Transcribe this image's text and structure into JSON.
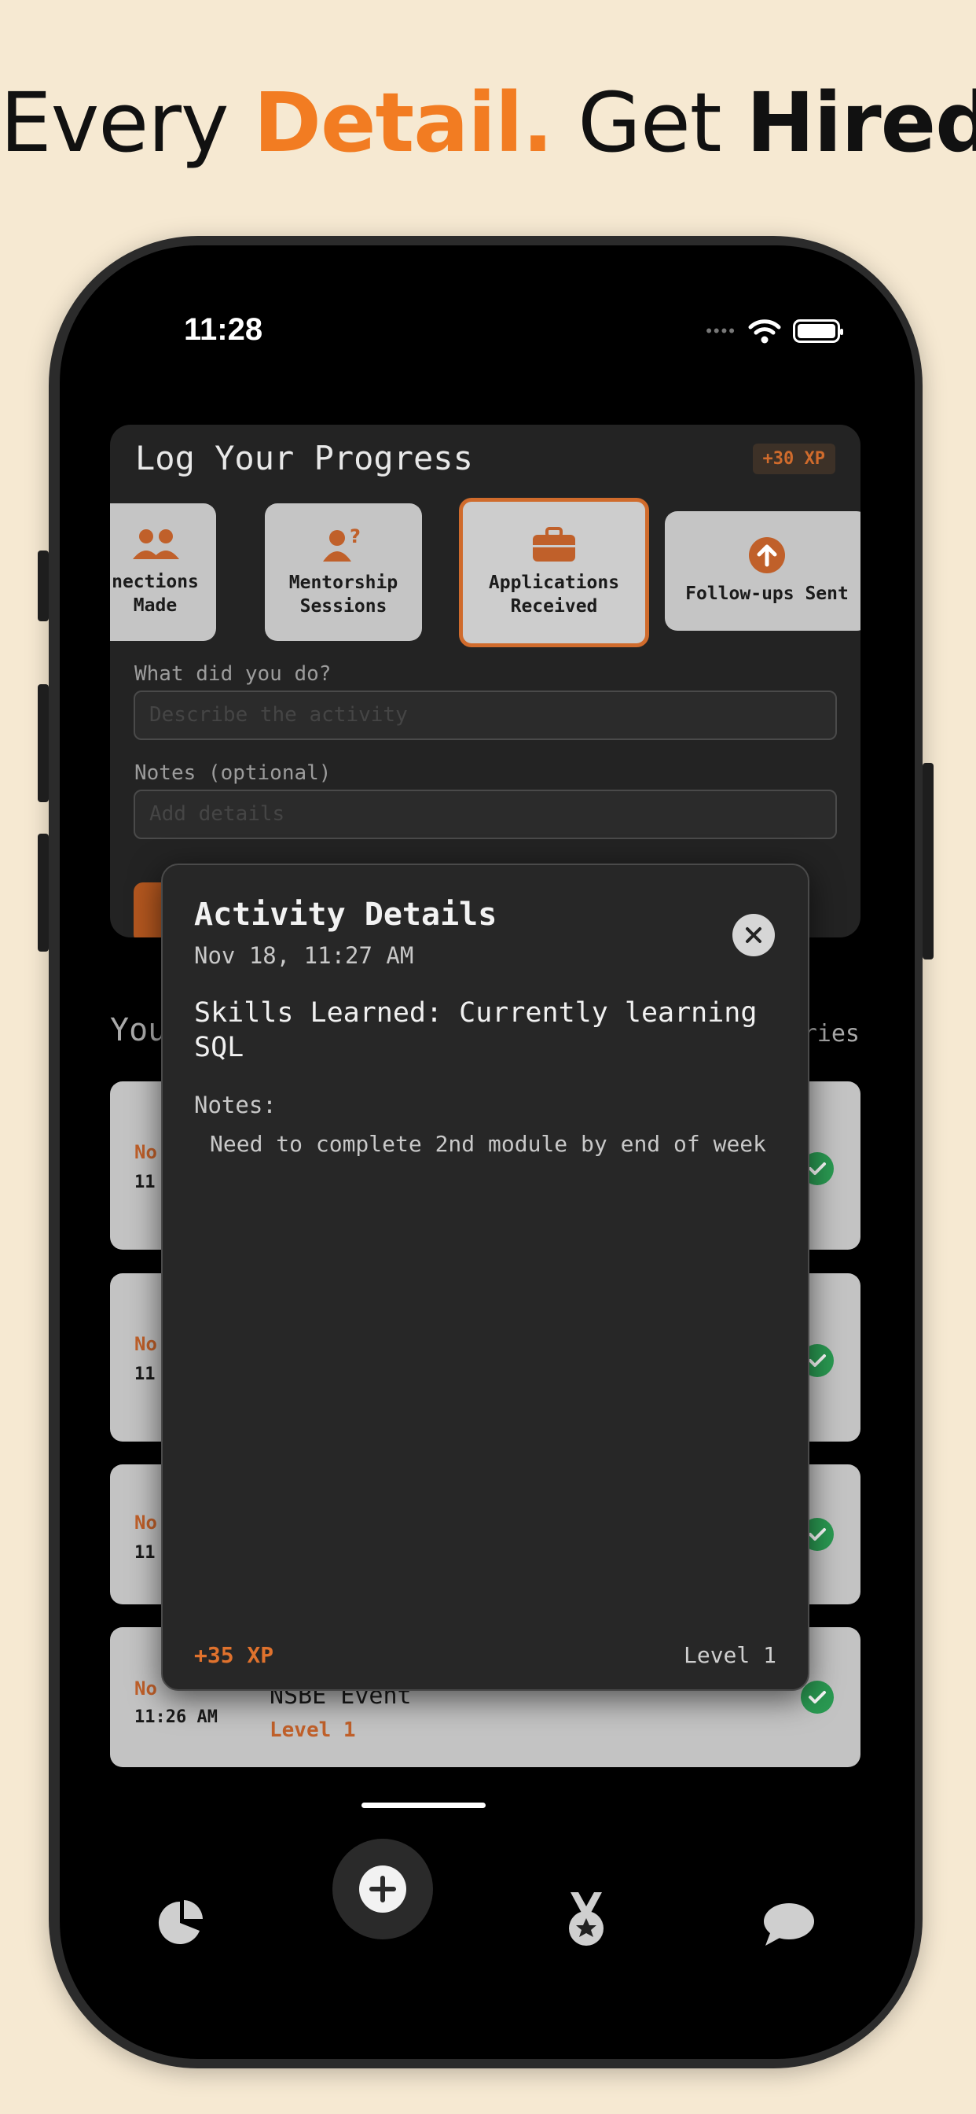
{
  "headline": {
    "part1": "Every ",
    "accent": "Detail.",
    "part2": " Get ",
    "bold": "Hired."
  },
  "status_bar": {
    "time": "11:28",
    "dots": "••••"
  },
  "progress_card": {
    "title": "Log Your Progress",
    "xp_badge": "+30 XP",
    "categories": [
      {
        "line1": "nections",
        "line2": "Made",
        "icon": "people-icon"
      },
      {
        "line1": "Mentorship",
        "line2": "Sessions",
        "icon": "mentor-question-icon"
      },
      {
        "line1": "Applications",
        "line2": "Received",
        "icon": "briefcase-icon",
        "selected": true
      },
      {
        "line1": "Follow-ups Sent",
        "line2": "",
        "icon": "arrow-up-circle-icon"
      }
    ],
    "what_label": "What did you do?",
    "what_placeholder": "Describe the activity",
    "notes_label": "Notes (optional)",
    "notes_placeholder": "Add details"
  },
  "section": {
    "title": "You",
    "link": "ries"
  },
  "log_items": [
    {
      "cat": "No",
      "time": "11"
    },
    {
      "cat": "No",
      "time": "11"
    },
    {
      "cat": "No",
      "time": "11"
    },
    {
      "cat": "No",
      "time": "11:26 AM",
      "name": "NSBE Event",
      "level": "Level 1"
    }
  ],
  "modal": {
    "title": "Activity Details",
    "date": "Nov 18, 11:27 AM",
    "summary": "Skills Learned: Currently learning SQL",
    "notes_label": "Notes:",
    "notes": "Need to complete 2nd module by end of week",
    "xp": "+35 XP",
    "level": "Level 1"
  },
  "tab_bar": {
    "items": [
      "stats-icon",
      "add-icon",
      "medal-icon",
      "chat-icon"
    ]
  },
  "colors": {
    "accent": "#f27c22",
    "brand_dark_orange": "#c0602a",
    "success": "#2a9a52",
    "background": "#f6e9d2"
  }
}
